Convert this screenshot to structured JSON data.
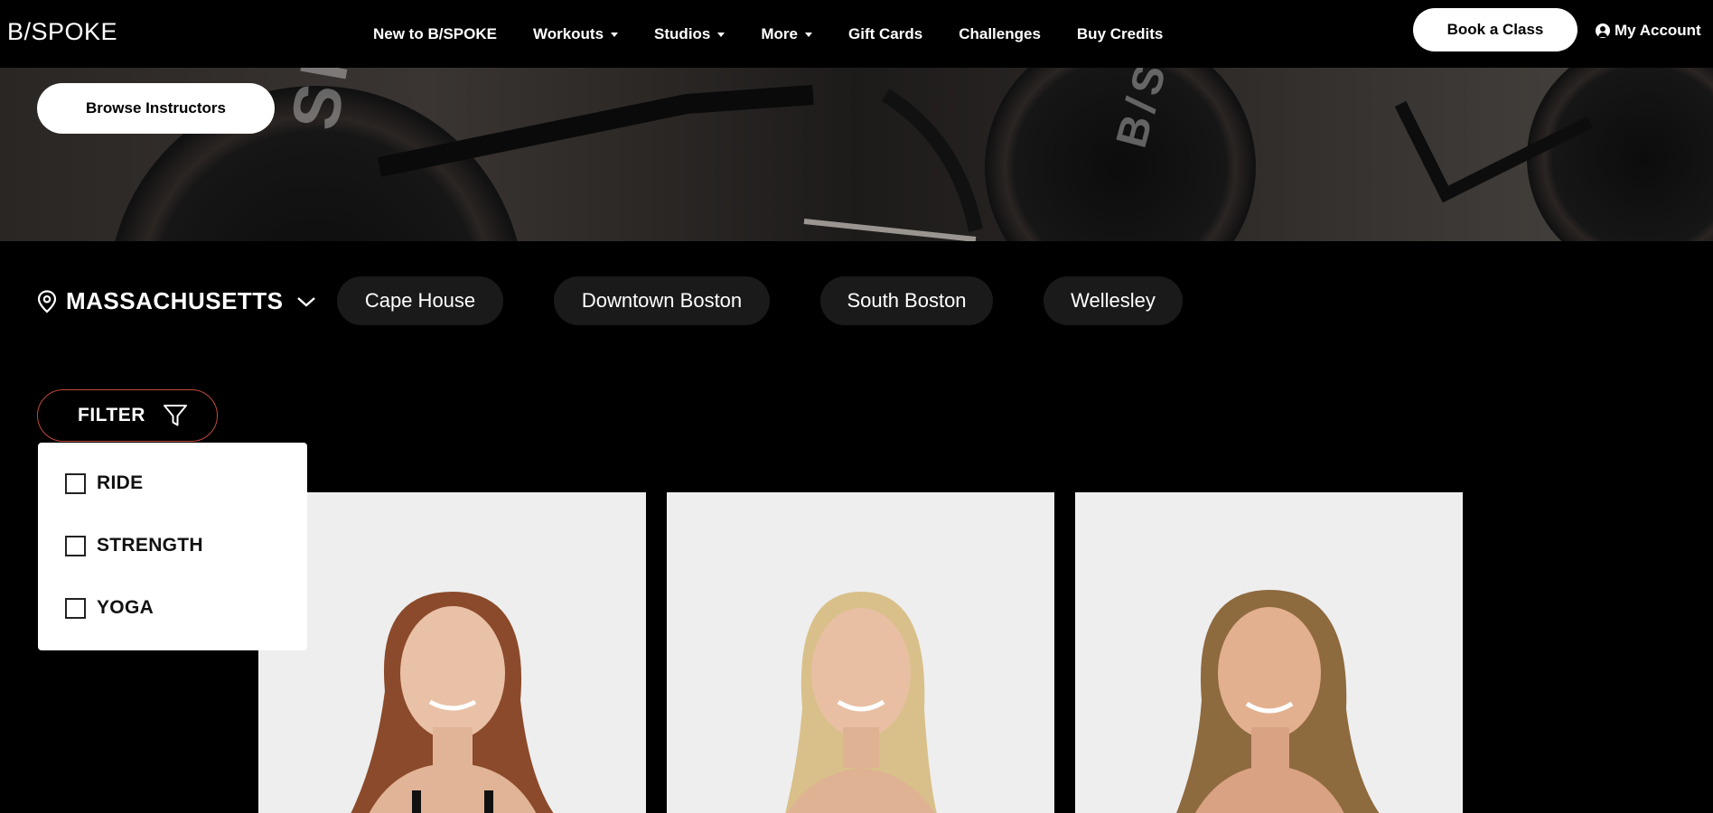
{
  "nav": {
    "logo": "B/SPOKE",
    "links": [
      {
        "label": "New to B/SPOKE",
        "dropdown": false
      },
      {
        "label": "Workouts",
        "dropdown": true
      },
      {
        "label": "Studios",
        "dropdown": true
      },
      {
        "label": "More",
        "dropdown": true
      },
      {
        "label": "Gift Cards",
        "dropdown": false
      },
      {
        "label": "Challenges",
        "dropdown": false
      },
      {
        "label": "Buy Credits",
        "dropdown": false
      }
    ],
    "book_label": "Book a Class",
    "account_label": "My Account"
  },
  "hero": {
    "browse_label": "Browse Instructors",
    "bg_text_1": "SPOK",
    "bg_text_2": "B/S"
  },
  "location": {
    "region": "MASSACHUSETTS",
    "studios": [
      "Cape House",
      "Downtown Boston",
      "South Boston",
      "Wellesley"
    ]
  },
  "filter": {
    "label": "FILTER",
    "options": [
      "RIDE",
      "STRENGTH",
      "YOGA"
    ]
  },
  "colors": {
    "accent_border": "#c04a3d",
    "background": "#000000",
    "card_bg": "#eeeeee"
  },
  "icons": {
    "location": "map-pin-icon",
    "region_toggle": "chevron-down-icon",
    "filter": "funnel-icon",
    "account": "user-circle-icon"
  }
}
